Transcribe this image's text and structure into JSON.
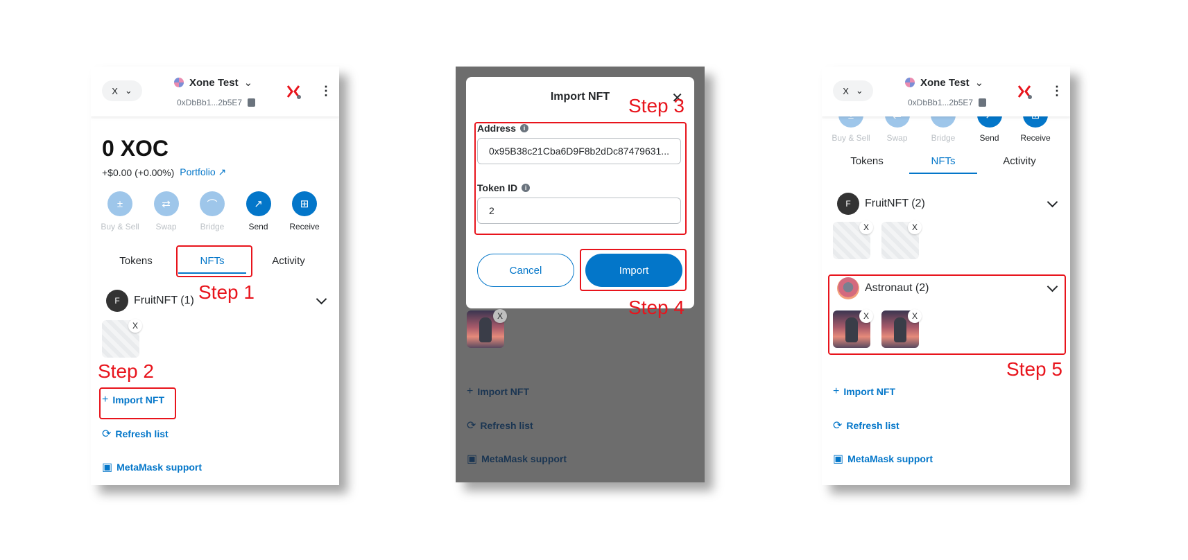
{
  "header": {
    "network_label": "X",
    "account_name": "Xone Test",
    "account_address": "0xDbBb1...2b5E7"
  },
  "panel1": {
    "balance": "0 XOC",
    "fiat_change": "+$0.00 (+0.00%)",
    "portfolio_link": "Portfolio",
    "actions": [
      "Buy & Sell",
      "Swap",
      "Bridge",
      "Send",
      "Receive"
    ],
    "tabs": [
      "Tokens",
      "NFTs",
      "Activity"
    ],
    "collection": {
      "avatar_letter": "F",
      "name": "FruitNFT (1)"
    },
    "nft_badge": "X",
    "links": {
      "import": "Import NFT",
      "refresh": "Refresh list",
      "support": "MetaMask support"
    }
  },
  "modal": {
    "title": "Import NFT",
    "address_label": "Address",
    "address_value": "0x95B38c21Cba6D9F8b2dDc87479631...",
    "token_id_label": "Token ID",
    "token_id_value": "2",
    "cancel": "Cancel",
    "import": "Import"
  },
  "panel2": {
    "nft_badge": "X",
    "links": {
      "import": "Import NFT",
      "refresh": "Refresh list",
      "support": "MetaMask support"
    }
  },
  "panel3": {
    "actions": [
      "Buy & Sell",
      "Swap",
      "Bridge",
      "Send",
      "Receive"
    ],
    "tabs": [
      "Tokens",
      "NFTs",
      "Activity"
    ],
    "collection1": {
      "avatar_letter": "F",
      "name": "FruitNFT (2)"
    },
    "collection2": {
      "name": "Astronaut (2)"
    },
    "nft_badge": "X",
    "links": {
      "import": "Import NFT",
      "refresh": "Refresh list",
      "support": "MetaMask support"
    }
  },
  "steps": {
    "step1": "Step 1",
    "step2": "Step 2",
    "step3": "Step 3",
    "step4": "Step 4",
    "step5": "Step 5"
  },
  "colors": {
    "accent": "#0376c9",
    "annotation_red": "#e8141c",
    "overlay_gray": "#6d6d6d"
  },
  "icons": [
    "chevron-down-icon",
    "account-avatar-icon",
    "copy-icon",
    "xone-logo-icon",
    "kebab-menu-icon",
    "buy-sell-icon",
    "swap-icon",
    "bridge-icon",
    "send-icon",
    "receive-icon",
    "plus-icon",
    "refresh-icon",
    "support-icon",
    "close-icon",
    "info-icon"
  ]
}
